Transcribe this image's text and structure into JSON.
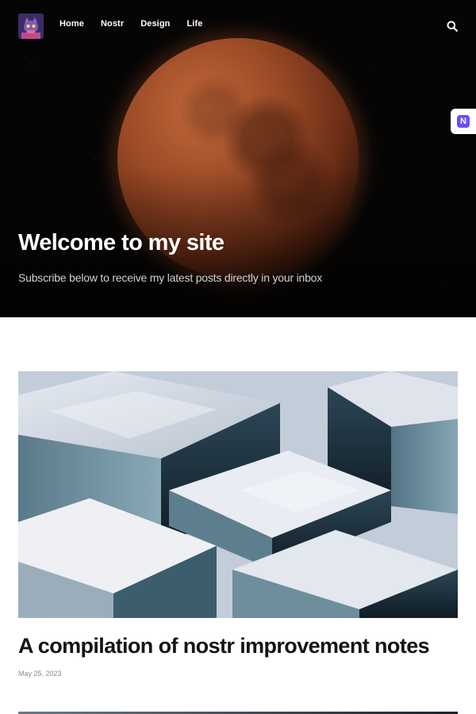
{
  "site": {
    "logo_icon": "avatar-logo-icon"
  },
  "nav": {
    "items": [
      {
        "label": "Home"
      },
      {
        "label": "Nostr"
      },
      {
        "label": "Design"
      },
      {
        "label": "Life"
      }
    ],
    "search_icon": "search-icon"
  },
  "side_widget": {
    "letter": "N",
    "icon": "nostr-icon",
    "color": "#6c4cf5"
  },
  "hero": {
    "title": "Welcome to my site",
    "subtitle": "Subscribe below to receive my latest posts directly in your inbox"
  },
  "posts": [
    {
      "title": "A compilation of nostr improvement notes",
      "date": "May 25, 2023"
    }
  ]
}
